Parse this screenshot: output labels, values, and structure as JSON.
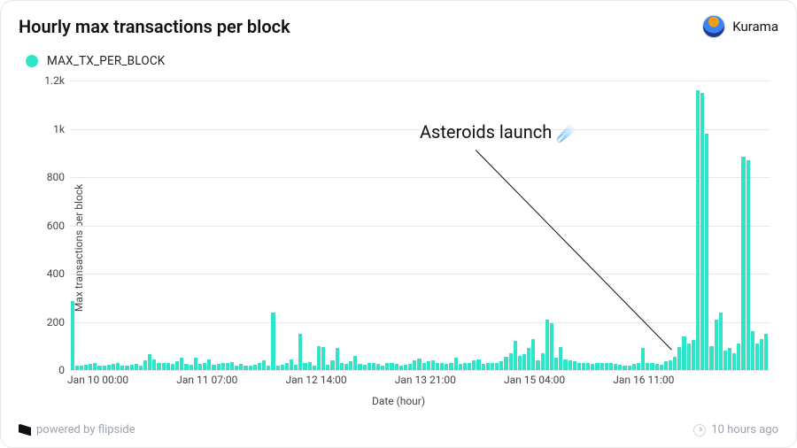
{
  "header": {
    "title": "Hourly max transactions per block",
    "username": "Kurama"
  },
  "legend": {
    "series_label": "MAX_TX_PER_BLOCK"
  },
  "annotation": {
    "text": "Asteroids launch ☄️"
  },
  "footer": {
    "powered": "powered by flipside",
    "age": "10 hours ago"
  },
  "chart_data": {
    "type": "bar",
    "title": "Hourly max transactions per block",
    "xlabel": "Date (hour)",
    "ylabel": "Max transactions per block",
    "ylim": [
      0,
      1200
    ],
    "yticks": [
      0,
      200,
      400,
      600,
      800,
      1000,
      1200
    ],
    "ytick_labels": [
      "0",
      "200",
      "400",
      "600",
      "800",
      "1k",
      "1.2k"
    ],
    "xticks": [
      "Jan 10 00:00",
      "Jan 11 07:00",
      "Jan 12 14:00",
      "Jan 13 21:00",
      "Jan 15 04:00",
      "Jan 16 11:00"
    ],
    "accent": "#2ee6c7",
    "series": [
      {
        "name": "MAX_TX_PER_BLOCK",
        "values": [
          285,
          20,
          18,
          22,
          25,
          28,
          20,
          18,
          22,
          25,
          28,
          20,
          18,
          22,
          25,
          20,
          40,
          65,
          45,
          30,
          28,
          30,
          24,
          38,
          52,
          24,
          22,
          50,
          26,
          28,
          44,
          22,
          24,
          30,
          28,
          32,
          20,
          25,
          18,
          20,
          22,
          30,
          42,
          20,
          240,
          18,
          22,
          28,
          44,
          22,
          150,
          28,
          34,
          20,
          100,
          95,
          22,
          40,
          90,
          30,
          24,
          36,
          60,
          24,
          22,
          28,
          30,
          24,
          20,
          28,
          30,
          24,
          20,
          22,
          26,
          40,
          48,
          30,
          38,
          42,
          28,
          30,
          24,
          30,
          50,
          26,
          30,
          28,
          40,
          45,
          25,
          30,
          28,
          30,
          35,
          55,
          70,
          120,
          60,
          65,
          90,
          130,
          40,
          70,
          210,
          195,
          50,
          95,
          45,
          40,
          35,
          30,
          28,
          30,
          26,
          30,
          28,
          30,
          28,
          24,
          22,
          20,
          18,
          26,
          30,
          90,
          30,
          28,
          24,
          22,
          35,
          40,
          55,
          95,
          140,
          110,
          125,
          1160,
          1150,
          980,
          100,
          210,
          240,
          80,
          90,
          70,
          110,
          885,
          870,
          160,
          110,
          130,
          150
        ]
      }
    ]
  }
}
